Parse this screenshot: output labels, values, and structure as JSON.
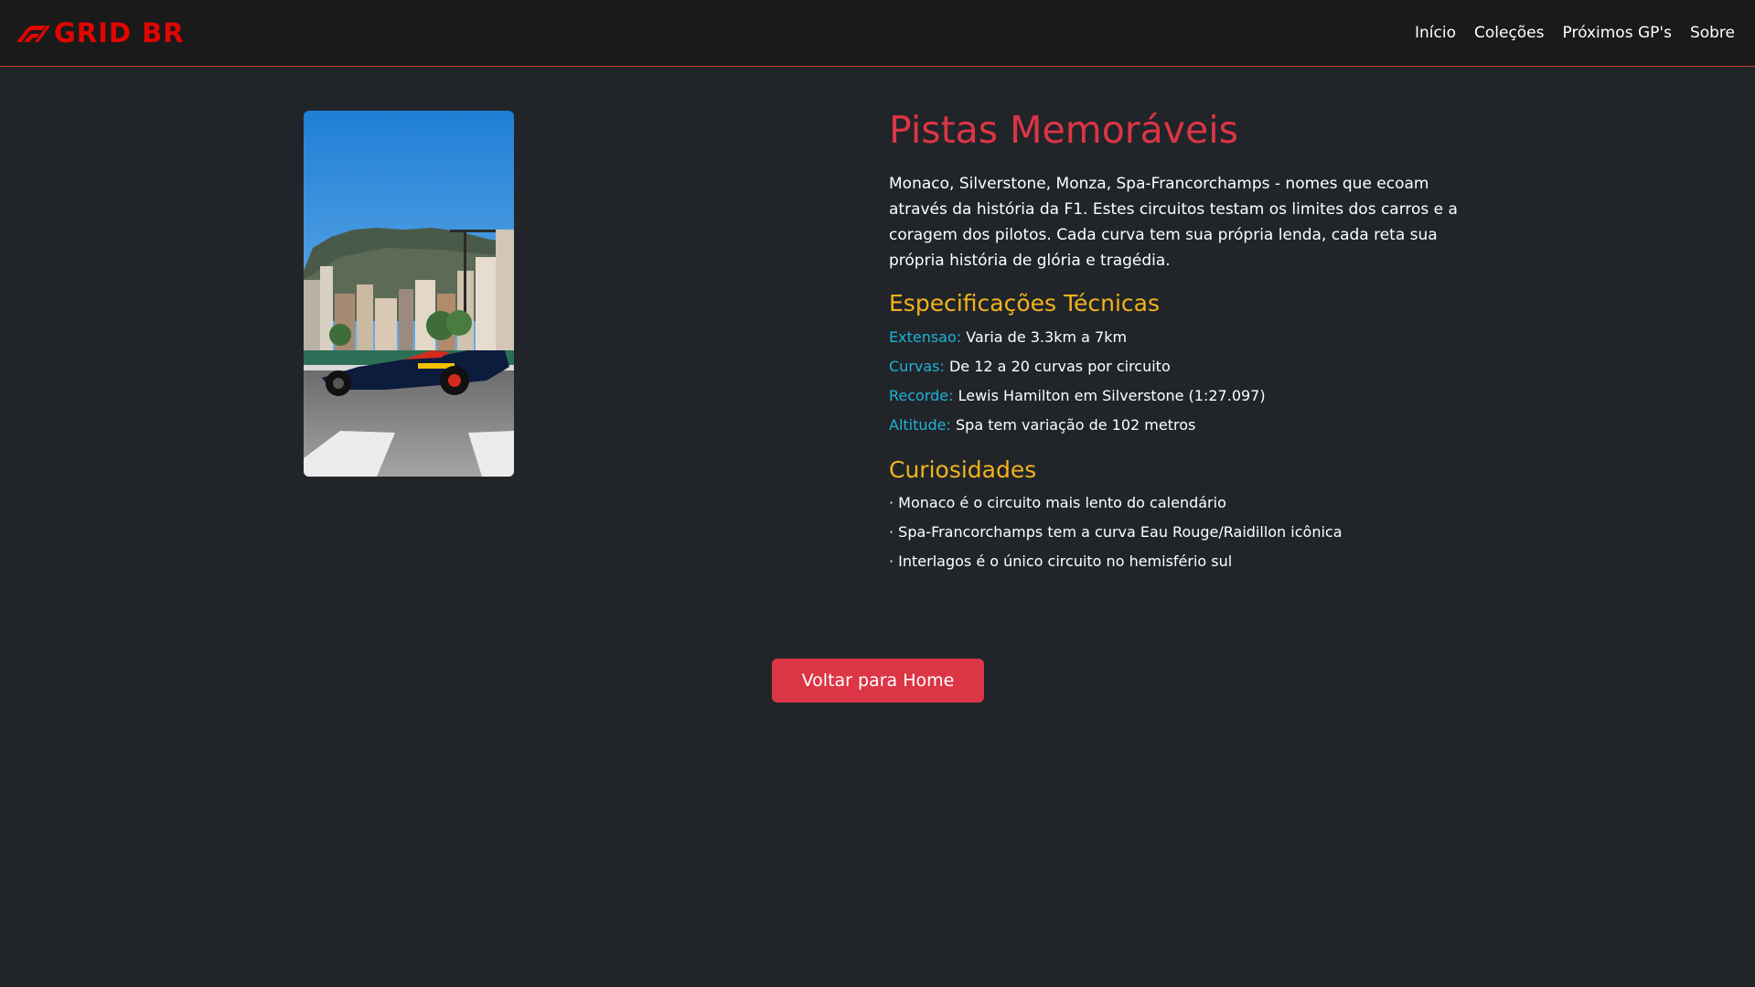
{
  "nav": {
    "brand": "GRID BR",
    "links": [
      "Início",
      "Coleções",
      "Próximos GP's",
      "Sobre"
    ]
  },
  "colors": {
    "accent_red": "#dc3545",
    "brand_red": "#e10600",
    "heading_yellow": "#f2b21c",
    "label_cyan": "#1db3d6",
    "background": "#212529"
  },
  "main": {
    "title": "Pistas Memoráveis",
    "intro": "Monaco, Silverstone, Monza, Spa-Francorchamps - nomes que ecoam através da história da F1. Estes circuitos testam os limites dos carros e a coragem dos pilotos. Cada curva tem sua própria lenda, cada reta sua própria história de glória e tragédia.",
    "specs_title": "Especificações Técnicas",
    "specs": [
      {
        "key": "Extensao:",
        "value": " Varia de 3.3km a 7km"
      },
      {
        "key": "Curvas:",
        "value": " De 12 a 20 curvas por circuito"
      },
      {
        "key": "Recorde:",
        "value": " Lewis Hamilton em Silverstone (1:27.097)"
      },
      {
        "key": "Altitude:",
        "value": " Spa tem variação de 102 metros"
      }
    ],
    "facts_title": "Curiosidades",
    "facts": [
      "· Monaco é o circuito mais lento do calendário",
      "· Spa-Francorchamps tem a curva Eau Rouge/Raidillon icônica",
      "· Interlagos é o único circuito no hemisfério sul"
    ],
    "back_button": "Voltar para Home"
  }
}
